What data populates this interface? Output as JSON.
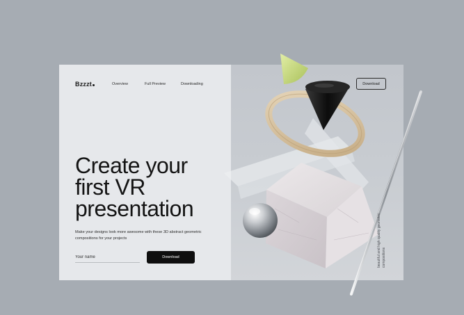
{
  "brand": {
    "logo_text": "Bzzzt"
  },
  "nav": {
    "items": [
      {
        "label": "Overview"
      },
      {
        "label": "Full Preview"
      },
      {
        "label": "Downloading"
      }
    ],
    "download_button": "Download"
  },
  "hero": {
    "title_line1": "Create your",
    "title_line2": "first VR",
    "title_line3": "presentation",
    "subtitle": "Make your designs look more awesome with these 3D abstract geometric compositions for your projects",
    "name_placeholder": "Your name",
    "download_button": "Download"
  },
  "side_caption": {
    "line1": "beautiful and high quality geometric",
    "line2": "compositions"
  },
  "colors": {
    "page_background": "#a6acb3",
    "card_left": "#e6e8eb",
    "card_right": "#c6cacf",
    "primary_button": "#0e0e0e",
    "cone_green": "#cfe08a",
    "cone_black": "#141414",
    "ring_wood": "#d8c6a8"
  },
  "objects": [
    "green-cone",
    "wooden-ring",
    "black-cone",
    "glass-prism",
    "marble-cube",
    "chrome-sphere",
    "metal-rod"
  ]
}
